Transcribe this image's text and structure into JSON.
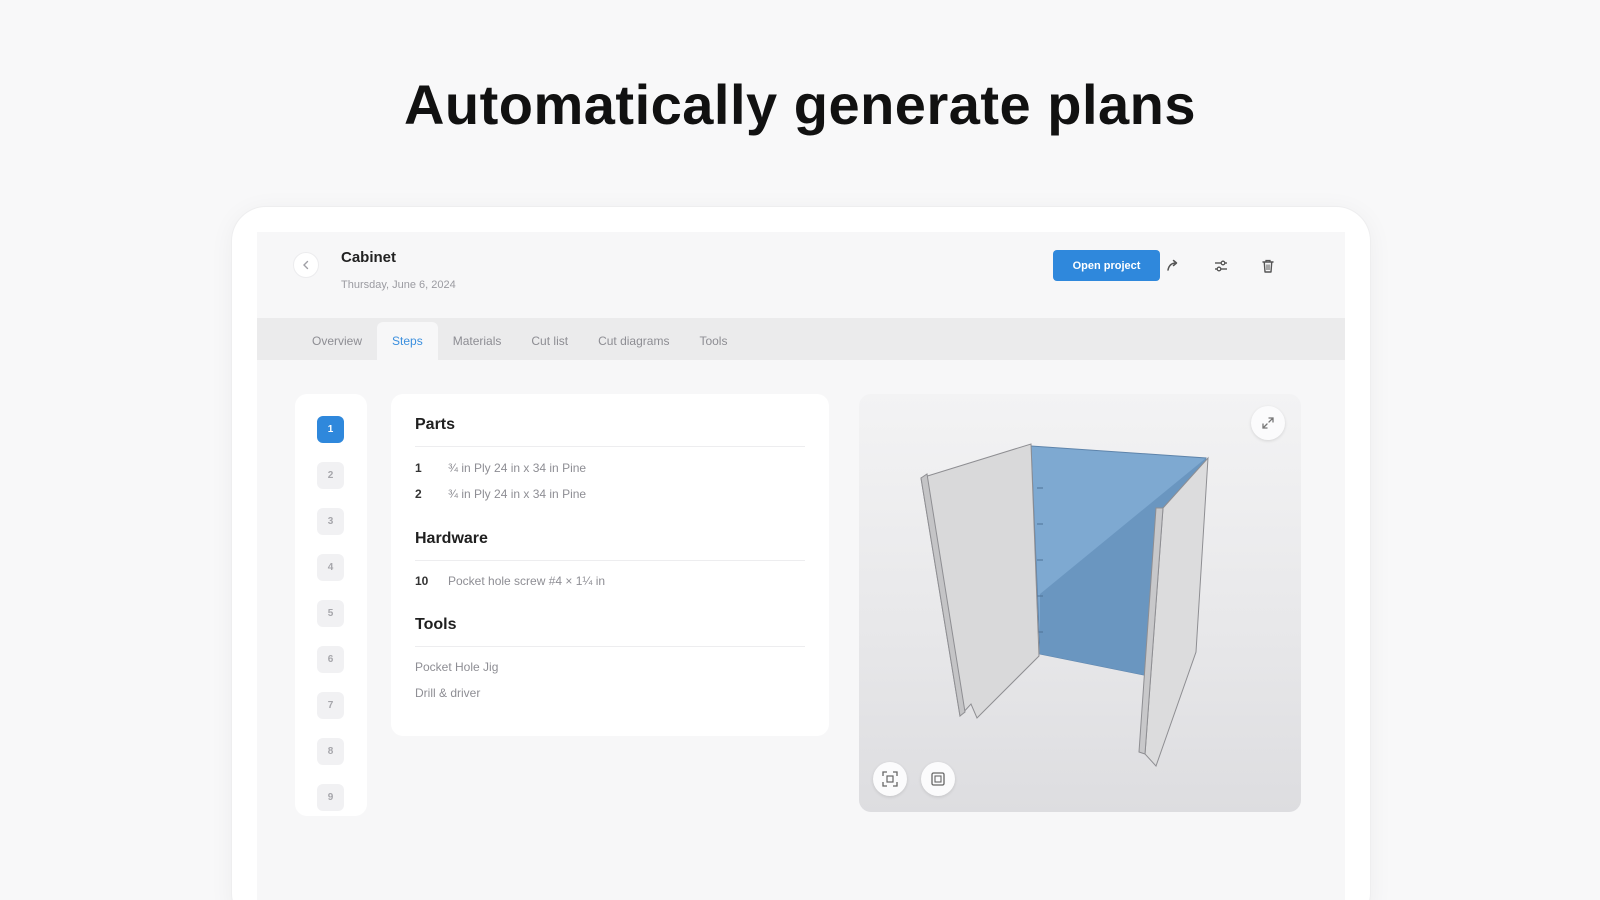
{
  "headline": "Automatically generate plans",
  "header": {
    "back_icon": "chevron-left-icon",
    "title": "Cabinet",
    "date": "Thursday, June 6, 2024",
    "open_button": "Open project",
    "actions": [
      "share-icon",
      "sliders-icon",
      "trash-icon"
    ]
  },
  "tabs": [
    {
      "label": "Overview",
      "active": false
    },
    {
      "label": "Steps",
      "active": true
    },
    {
      "label": "Materials",
      "active": false
    },
    {
      "label": "Cut list",
      "active": false
    },
    {
      "label": "Cut diagrams",
      "active": false
    },
    {
      "label": "Tools",
      "active": false
    }
  ],
  "steps": [
    "1",
    "2",
    "3",
    "4",
    "5",
    "6",
    "7",
    "8",
    "9"
  ],
  "active_step": "1",
  "details": {
    "parts_title": "Parts",
    "parts": [
      {
        "qty": "1",
        "label": "¾ in Ply 24 in x 34 in Pine"
      },
      {
        "qty": "2",
        "label": "¾ in Ply 24 in x 34 in Pine"
      }
    ],
    "hardware_title": "Hardware",
    "hardware": [
      {
        "qty": "10",
        "label": "Pocket hole screw #4 × 1¼ in"
      }
    ],
    "tools_title": "Tools",
    "tools": [
      "Pocket Hole Jig",
      "Drill & driver"
    ]
  },
  "viewer": {
    "expand_icon": "expand-icon",
    "fit_icon": "fit-view-icon",
    "layers_icon": "layers-icon"
  },
  "colors": {
    "accent": "#2f88dc",
    "panel_blue": "#7ea9d1",
    "panel_gray": "#d8d8d8"
  }
}
